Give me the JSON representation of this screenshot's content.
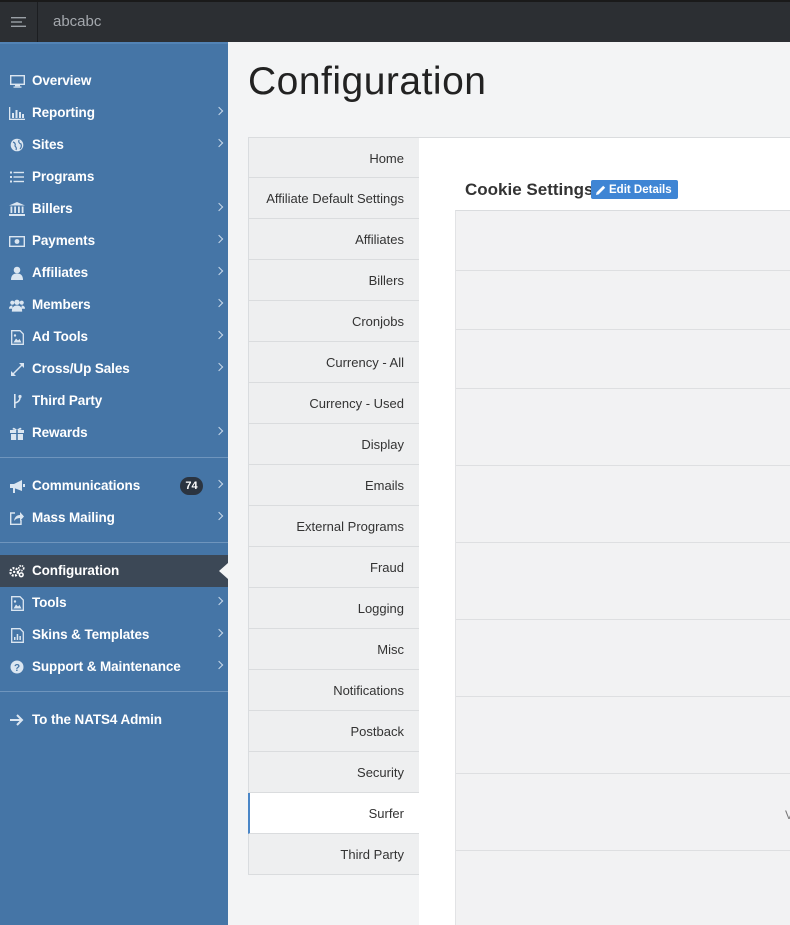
{
  "topbar": {
    "site_name": "abcabc"
  },
  "sidebar": {
    "items": [
      {
        "label": "Overview",
        "icon": "monitor-icon",
        "chevron": false
      },
      {
        "label": "Reporting",
        "icon": "bar-chart-icon",
        "chevron": true
      },
      {
        "label": "Sites",
        "icon": "globe-icon",
        "chevron": true
      },
      {
        "label": "Programs",
        "icon": "list-icon",
        "chevron": false
      },
      {
        "label": "Billers",
        "icon": "bank-icon",
        "chevron": true
      },
      {
        "label": "Payments",
        "icon": "money-icon",
        "chevron": true
      },
      {
        "label": "Affiliates",
        "icon": "user-icon",
        "chevron": true
      },
      {
        "label": "Members",
        "icon": "users-icon",
        "chevron": true
      },
      {
        "label": "Ad Tools",
        "icon": "image-icon",
        "chevron": true
      },
      {
        "label": "Cross/Up Sales",
        "icon": "expand-arrows-icon",
        "chevron": true
      },
      {
        "label": "Third Party",
        "icon": "branch-icon",
        "chevron": false
      },
      {
        "label": "Rewards",
        "icon": "gift-icon",
        "chevron": true
      },
      {
        "label": "Communications",
        "icon": "bullhorn-icon",
        "chevron": true,
        "badge": "74"
      },
      {
        "label": "Mass Mailing",
        "icon": "share-icon",
        "chevron": true
      },
      {
        "label": "Configuration",
        "icon": "gears-icon",
        "chevron": false,
        "active": true
      },
      {
        "label": "Tools",
        "icon": "image-icon",
        "chevron": true
      },
      {
        "label": "Skins & Templates",
        "icon": "file-chart-icon",
        "chevron": true
      },
      {
        "label": "Support & Maintenance",
        "icon": "question-icon",
        "chevron": true
      },
      {
        "label": "To the NATS4 Admin",
        "icon": "arrow-right-icon",
        "chevron": false
      }
    ]
  },
  "main": {
    "title": "Configuration",
    "tabs": [
      "Home",
      "Affiliate Default Settings",
      "Affiliates",
      "Billers",
      "Cronjobs",
      "Currency - All",
      "Currency - Used",
      "Display",
      "Emails",
      "External Programs",
      "Fraud",
      "Logging",
      "Misc",
      "Notifications",
      "Postback",
      "Security",
      "Surfer",
      "Third Party"
    ],
    "active_tab": "Surfer",
    "section_title": "Cookie Settings",
    "edit_label": "Edit Details",
    "stray_text": "V"
  },
  "colors": {
    "sidebar": "#4575a6",
    "topbar": "#2c2f33",
    "active_nav": "#3c4856",
    "accent": "#3f85d4"
  }
}
